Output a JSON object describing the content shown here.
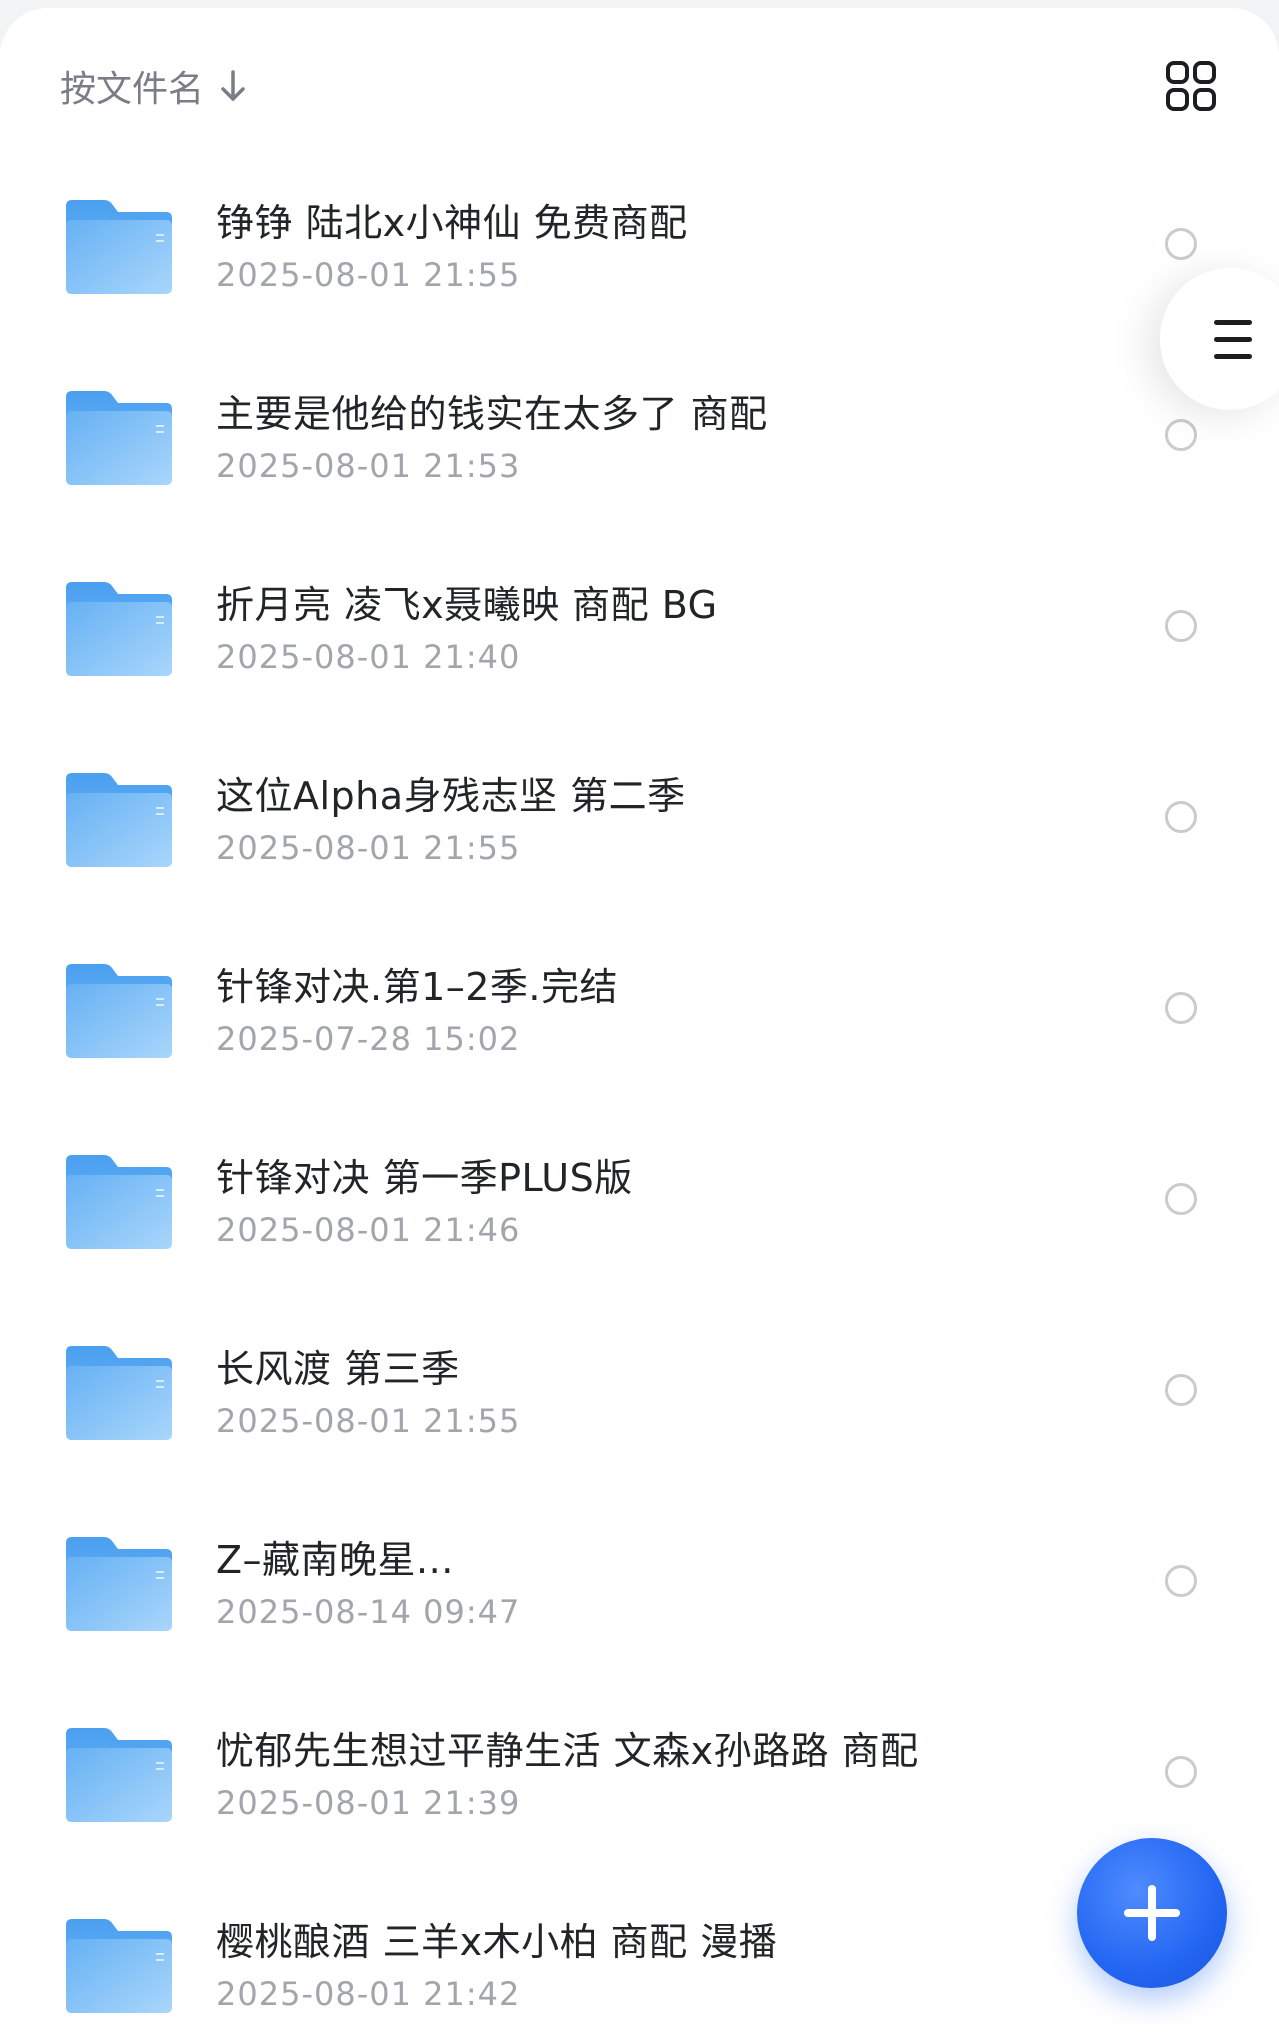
{
  "header": {
    "sort_label": "按文件名",
    "sort_icon": "arrow-down-icon",
    "view_toggle_icon": "grid-view-icon"
  },
  "side_menu": {
    "icon": "hamburger-menu-icon"
  },
  "fab": {
    "icon": "plus-icon"
  },
  "colors": {
    "folder_light": "#a9d6fb",
    "folder_dark": "#5aaaf2",
    "accent": "#2366f2"
  },
  "files": [
    {
      "name": "铮铮 陆北x小神仙 免费商配",
      "date": "2025-08-01 21:55"
    },
    {
      "name": "主要是他给的钱实在太多了 商配",
      "date": "2025-08-01 21:53"
    },
    {
      "name": "折月亮 凌飞x聂曦映 商配 BG",
      "date": "2025-08-01 21:40"
    },
    {
      "name": "这位Alpha身残志坚 第二季",
      "date": "2025-08-01 21:55"
    },
    {
      "name": "针锋对决.第1–2季.完结",
      "date": "2025-07-28 15:02"
    },
    {
      "name": "针锋对决 第一季PLUS版",
      "date": "2025-08-01 21:46"
    },
    {
      "name": "长风渡 第三季",
      "date": "2025-08-01 21:55"
    },
    {
      "name": "Z–藏南晚星...",
      "date": "2025-08-14 09:47"
    },
    {
      "name": "忧郁先生想过平静生活 文森x孙路路 商配",
      "date": "2025-08-01 21:39"
    },
    {
      "name": "樱桃酿酒 三羊x木小柏 商配 漫播",
      "date": "2025-08-01 21:42"
    }
  ]
}
